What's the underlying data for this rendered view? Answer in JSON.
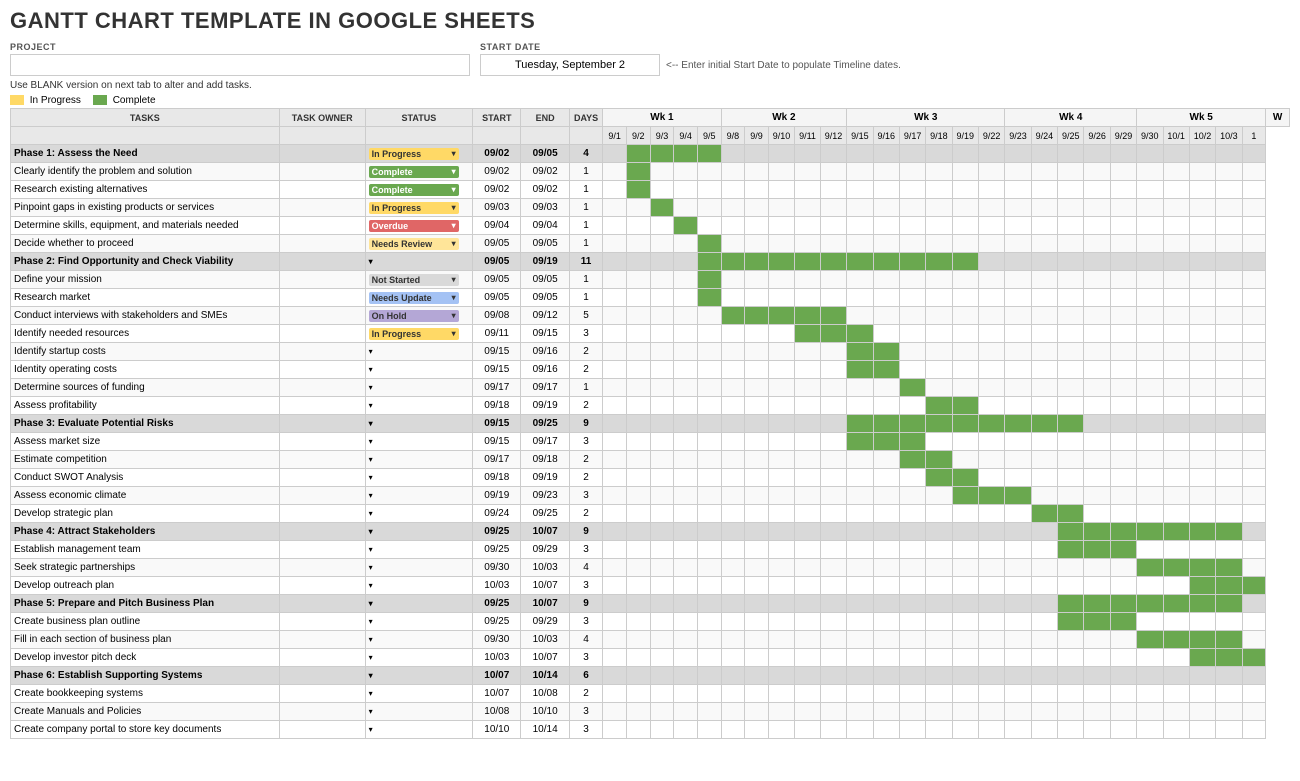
{
  "title": "GANTT CHART TEMPLATE IN GOOGLE SHEETS",
  "project_label": "PROJECT",
  "project_value": "",
  "start_date_label": "START DATE",
  "start_date_value": "Tuesday, September 2",
  "start_date_hint": "<-- Enter initial Start Date to populate Timeline dates.",
  "instructions": "Use BLANK version on next tab to alter and add tasks.",
  "headers": {
    "tasks": "TASKS",
    "owner": "TASK OWNER",
    "status": "STATUS",
    "start": "START",
    "end": "END",
    "days": "DAYS"
  },
  "weeks": [
    {
      "label": "Wk 1",
      "span": 5
    },
    {
      "label": "Wk 2",
      "span": 5
    },
    {
      "label": "Wk 3",
      "span": 6
    },
    {
      "label": "Wk 4",
      "span": 5
    },
    {
      "label": "Wk 5",
      "span": 5
    },
    {
      "label": "W",
      "span": 1
    }
  ],
  "days": [
    "9/1",
    "9/2",
    "9/3",
    "9/4",
    "9/5",
    "9/8",
    "9/9",
    "9/10",
    "9/11",
    "9/12",
    "9/15",
    "9/16",
    "9/17",
    "9/18",
    "9/19",
    "9/22",
    "9/23",
    "9/24",
    "9/25",
    "9/26",
    "9/29",
    "9/30",
    "10/1",
    "10/2",
    "10/3",
    "1"
  ],
  "rows": [
    {
      "type": "phase",
      "task": "Phase 1: Assess the Need",
      "owner": "",
      "status": "In Progress",
      "status_class": "status-in-progress",
      "start": "09/02",
      "end": "09/05",
      "days": "4",
      "bars": [
        0,
        1,
        1,
        1,
        1,
        0,
        0,
        0,
        0,
        0,
        0,
        0,
        0,
        0,
        0,
        0,
        0,
        0,
        0,
        0,
        0,
        0,
        0,
        0,
        0,
        0
      ]
    },
    {
      "type": "task",
      "task": "Clearly identify the problem and solution",
      "owner": "",
      "status": "Complete",
      "status_class": "status-complete",
      "start": "09/02",
      "end": "09/02",
      "days": "1",
      "bars": [
        0,
        1,
        0,
        0,
        0,
        0,
        0,
        0,
        0,
        0,
        0,
        0,
        0,
        0,
        0,
        0,
        0,
        0,
        0,
        0,
        0,
        0,
        0,
        0,
        0,
        0
      ]
    },
    {
      "type": "task",
      "task": "Research existing alternatives",
      "owner": "",
      "status": "Complete",
      "status_class": "status-complete",
      "start": "09/02",
      "end": "09/02",
      "days": "1",
      "bars": [
        0,
        1,
        0,
        0,
        0,
        0,
        0,
        0,
        0,
        0,
        0,
        0,
        0,
        0,
        0,
        0,
        0,
        0,
        0,
        0,
        0,
        0,
        0,
        0,
        0,
        0
      ]
    },
    {
      "type": "task",
      "task": "Pinpoint gaps in existing products or services",
      "owner": "",
      "status": "In Progress",
      "status_class": "status-in-progress",
      "start": "09/03",
      "end": "09/03",
      "days": "1",
      "bars": [
        0,
        0,
        1,
        0,
        0,
        0,
        0,
        0,
        0,
        0,
        0,
        0,
        0,
        0,
        0,
        0,
        0,
        0,
        0,
        0,
        0,
        0,
        0,
        0,
        0,
        0
      ]
    },
    {
      "type": "task",
      "task": "Determine skills, equipment, and materials needed",
      "owner": "",
      "status": "Overdue",
      "status_class": "status-overdue",
      "start": "09/04",
      "end": "09/04",
      "days": "1",
      "bars": [
        0,
        0,
        0,
        1,
        0,
        0,
        0,
        0,
        0,
        0,
        0,
        0,
        0,
        0,
        0,
        0,
        0,
        0,
        0,
        0,
        0,
        0,
        0,
        0,
        0,
        0
      ]
    },
    {
      "type": "task",
      "task": "Decide whether to proceed",
      "owner": "",
      "status": "Needs Review",
      "status_class": "status-needs-review",
      "start": "09/05",
      "end": "09/05",
      "days": "1",
      "bars": [
        0,
        0,
        0,
        0,
        1,
        0,
        0,
        0,
        0,
        0,
        0,
        0,
        0,
        0,
        0,
        0,
        0,
        0,
        0,
        0,
        0,
        0,
        0,
        0,
        0,
        0
      ]
    },
    {
      "type": "phase",
      "task": "Phase 2: Find Opportunity and Check Viability",
      "owner": "",
      "status": "",
      "status_class": "",
      "start": "09/05",
      "end": "09/19",
      "days": "11",
      "bars": [
        0,
        0,
        0,
        0,
        1,
        1,
        1,
        1,
        1,
        1,
        1,
        1,
        1,
        1,
        1,
        0,
        0,
        0,
        0,
        0,
        0,
        0,
        0,
        0,
        0,
        0
      ]
    },
    {
      "type": "task",
      "task": "Define your mission",
      "owner": "",
      "status": "Not Started",
      "status_class": "status-not-started",
      "start": "09/05",
      "end": "09/05",
      "days": "1",
      "bars": [
        0,
        0,
        0,
        0,
        1,
        0,
        0,
        0,
        0,
        0,
        0,
        0,
        0,
        0,
        0,
        0,
        0,
        0,
        0,
        0,
        0,
        0,
        0,
        0,
        0,
        0
      ]
    },
    {
      "type": "task",
      "task": "Research market",
      "owner": "",
      "status": "Needs Update",
      "status_class": "status-needs-update",
      "start": "09/05",
      "end": "09/05",
      "days": "1",
      "bars": [
        0,
        0,
        0,
        0,
        1,
        0,
        0,
        0,
        0,
        0,
        0,
        0,
        0,
        0,
        0,
        0,
        0,
        0,
        0,
        0,
        0,
        0,
        0,
        0,
        0,
        0
      ]
    },
    {
      "type": "task",
      "task": "Conduct interviews with stakeholders and SMEs",
      "owner": "",
      "status": "On Hold",
      "status_class": "status-on-hold",
      "start": "09/08",
      "end": "09/12",
      "days": "5",
      "bars": [
        0,
        0,
        0,
        0,
        0,
        1,
        1,
        1,
        1,
        1,
        0,
        0,
        0,
        0,
        0,
        0,
        0,
        0,
        0,
        0,
        0,
        0,
        0,
        0,
        0,
        0
      ]
    },
    {
      "type": "task",
      "task": "Identify needed resources",
      "owner": "",
      "status": "In Progress",
      "status_class": "status-in-progress",
      "start": "09/11",
      "end": "09/15",
      "days": "3",
      "bars": [
        0,
        0,
        0,
        0,
        0,
        0,
        0,
        0,
        1,
        1,
        1,
        0,
        0,
        0,
        0,
        0,
        0,
        0,
        0,
        0,
        0,
        0,
        0,
        0,
        0,
        0
      ]
    },
    {
      "type": "task",
      "task": "Identify startup costs",
      "owner": "",
      "status": "",
      "status_class": "",
      "start": "09/15",
      "end": "09/16",
      "days": "2",
      "bars": [
        0,
        0,
        0,
        0,
        0,
        0,
        0,
        0,
        0,
        0,
        1,
        1,
        0,
        0,
        0,
        0,
        0,
        0,
        0,
        0,
        0,
        0,
        0,
        0,
        0,
        0
      ]
    },
    {
      "type": "task",
      "task": "Identity operating costs",
      "owner": "",
      "status": "",
      "status_class": "",
      "start": "09/15",
      "end": "09/16",
      "days": "2",
      "bars": [
        0,
        0,
        0,
        0,
        0,
        0,
        0,
        0,
        0,
        0,
        1,
        1,
        0,
        0,
        0,
        0,
        0,
        0,
        0,
        0,
        0,
        0,
        0,
        0,
        0,
        0
      ]
    },
    {
      "type": "task",
      "task": "Determine sources of funding",
      "owner": "",
      "status": "",
      "status_class": "",
      "start": "09/17",
      "end": "09/17",
      "days": "1",
      "bars": [
        0,
        0,
        0,
        0,
        0,
        0,
        0,
        0,
        0,
        0,
        0,
        0,
        1,
        0,
        0,
        0,
        0,
        0,
        0,
        0,
        0,
        0,
        0,
        0,
        0,
        0
      ]
    },
    {
      "type": "task",
      "task": "Assess profitability",
      "owner": "",
      "status": "",
      "status_class": "",
      "start": "09/18",
      "end": "09/19",
      "days": "2",
      "bars": [
        0,
        0,
        0,
        0,
        0,
        0,
        0,
        0,
        0,
        0,
        0,
        0,
        0,
        1,
        1,
        0,
        0,
        0,
        0,
        0,
        0,
        0,
        0,
        0,
        0,
        0
      ]
    },
    {
      "type": "phase",
      "task": "Phase 3: Evaluate Potential Risks",
      "owner": "",
      "status": "",
      "status_class": "",
      "start": "09/15",
      "end": "09/25",
      "days": "9",
      "bars": [
        0,
        0,
        0,
        0,
        0,
        0,
        0,
        0,
        0,
        0,
        1,
        1,
        1,
        1,
        1,
        1,
        1,
        1,
        1,
        0,
        0,
        0,
        0,
        0,
        0,
        0
      ]
    },
    {
      "type": "task",
      "task": "Assess market size",
      "owner": "",
      "status": "",
      "status_class": "",
      "start": "09/15",
      "end": "09/17",
      "days": "3",
      "bars": [
        0,
        0,
        0,
        0,
        0,
        0,
        0,
        0,
        0,
        0,
        1,
        1,
        1,
        0,
        0,
        0,
        0,
        0,
        0,
        0,
        0,
        0,
        0,
        0,
        0,
        0
      ]
    },
    {
      "type": "task",
      "task": "Estimate competition",
      "owner": "",
      "status": "",
      "status_class": "",
      "start": "09/17",
      "end": "09/18",
      "days": "2",
      "bars": [
        0,
        0,
        0,
        0,
        0,
        0,
        0,
        0,
        0,
        0,
        0,
        0,
        1,
        1,
        0,
        0,
        0,
        0,
        0,
        0,
        0,
        0,
        0,
        0,
        0,
        0
      ]
    },
    {
      "type": "task",
      "task": "Conduct SWOT Analysis",
      "owner": "",
      "status": "",
      "status_class": "",
      "start": "09/18",
      "end": "09/19",
      "days": "2",
      "bars": [
        0,
        0,
        0,
        0,
        0,
        0,
        0,
        0,
        0,
        0,
        0,
        0,
        0,
        1,
        1,
        0,
        0,
        0,
        0,
        0,
        0,
        0,
        0,
        0,
        0,
        0
      ]
    },
    {
      "type": "task",
      "task": "Assess economic climate",
      "owner": "",
      "status": "",
      "status_class": "",
      "start": "09/19",
      "end": "09/23",
      "days": "3",
      "bars": [
        0,
        0,
        0,
        0,
        0,
        0,
        0,
        0,
        0,
        0,
        0,
        0,
        0,
        0,
        1,
        1,
        1,
        0,
        0,
        0,
        0,
        0,
        0,
        0,
        0,
        0
      ]
    },
    {
      "type": "task",
      "task": "Develop strategic plan",
      "owner": "",
      "status": "",
      "status_class": "",
      "start": "09/24",
      "end": "09/25",
      "days": "2",
      "bars": [
        0,
        0,
        0,
        0,
        0,
        0,
        0,
        0,
        0,
        0,
        0,
        0,
        0,
        0,
        0,
        0,
        0,
        1,
        1,
        0,
        0,
        0,
        0,
        0,
        0,
        0
      ]
    },
    {
      "type": "phase",
      "task": "Phase 4: Attract Stakeholders",
      "owner": "",
      "status": "",
      "status_class": "",
      "start": "09/25",
      "end": "10/07",
      "days": "9",
      "bars": [
        0,
        0,
        0,
        0,
        0,
        0,
        0,
        0,
        0,
        0,
        0,
        0,
        0,
        0,
        0,
        0,
        0,
        0,
        1,
        1,
        1,
        1,
        1,
        1,
        1,
        0
      ]
    },
    {
      "type": "task",
      "task": "Establish management team",
      "owner": "",
      "status": "",
      "status_class": "",
      "start": "09/25",
      "end": "09/29",
      "days": "3",
      "bars": [
        0,
        0,
        0,
        0,
        0,
        0,
        0,
        0,
        0,
        0,
        0,
        0,
        0,
        0,
        0,
        0,
        0,
        0,
        1,
        1,
        1,
        0,
        0,
        0,
        0,
        0
      ]
    },
    {
      "type": "task",
      "task": "Seek strategic partnerships",
      "owner": "",
      "status": "",
      "status_class": "",
      "start": "09/30",
      "end": "10/03",
      "days": "4",
      "bars": [
        0,
        0,
        0,
        0,
        0,
        0,
        0,
        0,
        0,
        0,
        0,
        0,
        0,
        0,
        0,
        0,
        0,
        0,
        0,
        0,
        0,
        1,
        1,
        1,
        1,
        0
      ]
    },
    {
      "type": "task",
      "task": "Develop outreach plan",
      "owner": "",
      "status": "",
      "status_class": "",
      "start": "10/03",
      "end": "10/07",
      "days": "3",
      "bars": [
        0,
        0,
        0,
        0,
        0,
        0,
        0,
        0,
        0,
        0,
        0,
        0,
        0,
        0,
        0,
        0,
        0,
        0,
        0,
        0,
        0,
        0,
        0,
        1,
        1,
        1
      ]
    },
    {
      "type": "phase",
      "task": "Phase 5: Prepare and Pitch Business Plan",
      "owner": "",
      "status": "",
      "status_class": "",
      "start": "09/25",
      "end": "10/07",
      "days": "9",
      "bars": [
        0,
        0,
        0,
        0,
        0,
        0,
        0,
        0,
        0,
        0,
        0,
        0,
        0,
        0,
        0,
        0,
        0,
        0,
        1,
        1,
        1,
        1,
        1,
        1,
        1,
        0
      ]
    },
    {
      "type": "task",
      "task": "Create business plan outline",
      "owner": "",
      "status": "",
      "status_class": "",
      "start": "09/25",
      "end": "09/29",
      "days": "3",
      "bars": [
        0,
        0,
        0,
        0,
        0,
        0,
        0,
        0,
        0,
        0,
        0,
        0,
        0,
        0,
        0,
        0,
        0,
        0,
        1,
        1,
        1,
        0,
        0,
        0,
        0,
        0
      ]
    },
    {
      "type": "task",
      "task": "Fill in each section of business plan",
      "owner": "",
      "status": "",
      "status_class": "",
      "start": "09/30",
      "end": "10/03",
      "days": "4",
      "bars": [
        0,
        0,
        0,
        0,
        0,
        0,
        0,
        0,
        0,
        0,
        0,
        0,
        0,
        0,
        0,
        0,
        0,
        0,
        0,
        0,
        0,
        1,
        1,
        1,
        1,
        0
      ]
    },
    {
      "type": "task",
      "task": "Develop investor pitch deck",
      "owner": "",
      "status": "",
      "status_class": "",
      "start": "10/03",
      "end": "10/07",
      "days": "3",
      "bars": [
        0,
        0,
        0,
        0,
        0,
        0,
        0,
        0,
        0,
        0,
        0,
        0,
        0,
        0,
        0,
        0,
        0,
        0,
        0,
        0,
        0,
        0,
        0,
        1,
        1,
        1
      ]
    },
    {
      "type": "phase",
      "task": "Phase 6: Establish Supporting Systems",
      "owner": "",
      "status": "",
      "status_class": "",
      "start": "10/07",
      "end": "10/14",
      "days": "6",
      "bars": [
        0,
        0,
        0,
        0,
        0,
        0,
        0,
        0,
        0,
        0,
        0,
        0,
        0,
        0,
        0,
        0,
        0,
        0,
        0,
        0,
        0,
        0,
        0,
        0,
        0,
        0
      ]
    },
    {
      "type": "task",
      "task": "Create bookkeeping systems",
      "owner": "",
      "status": "",
      "status_class": "",
      "start": "10/07",
      "end": "10/08",
      "days": "2",
      "bars": [
        0,
        0,
        0,
        0,
        0,
        0,
        0,
        0,
        0,
        0,
        0,
        0,
        0,
        0,
        0,
        0,
        0,
        0,
        0,
        0,
        0,
        0,
        0,
        0,
        0,
        0
      ]
    },
    {
      "type": "task",
      "task": "Create Manuals and Policies",
      "owner": "",
      "status": "",
      "status_class": "",
      "start": "10/08",
      "end": "10/10",
      "days": "3",
      "bars": [
        0,
        0,
        0,
        0,
        0,
        0,
        0,
        0,
        0,
        0,
        0,
        0,
        0,
        0,
        0,
        0,
        0,
        0,
        0,
        0,
        0,
        0,
        0,
        0,
        0,
        0
      ]
    },
    {
      "type": "task",
      "task": "Create company portal to store key documents",
      "owner": "",
      "status": "",
      "status_class": "",
      "start": "10/10",
      "end": "10/14",
      "days": "3",
      "bars": [
        0,
        0,
        0,
        0,
        0,
        0,
        0,
        0,
        0,
        0,
        0,
        0,
        0,
        0,
        0,
        0,
        0,
        0,
        0,
        0,
        0,
        0,
        0,
        0,
        0,
        0
      ]
    }
  ],
  "legend": {
    "in_progress_label": "In Progress",
    "complete_label": "Complete"
  }
}
